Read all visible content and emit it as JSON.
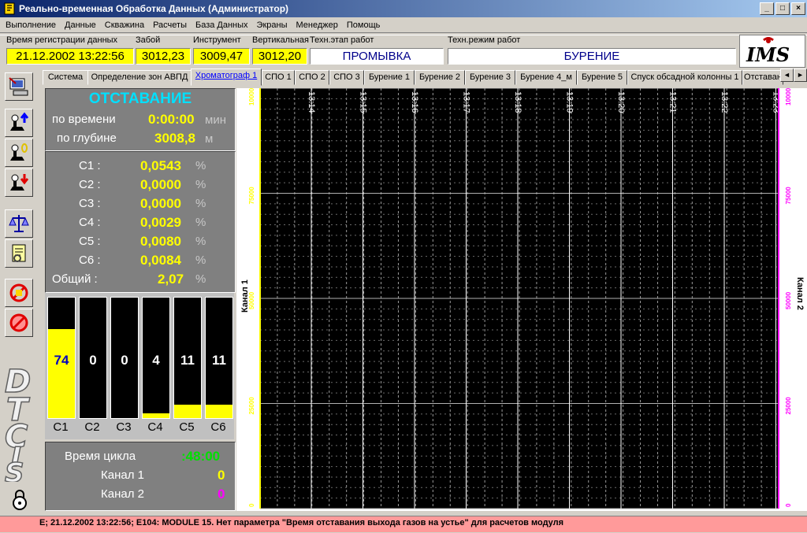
{
  "window": {
    "title": "Реально-временная Обработка Данных (Администратор)",
    "buttons": {
      "minimize": "_",
      "maximize": "□",
      "close": "×"
    }
  },
  "menu": [
    "Выполнение",
    "Данные",
    "Скважина",
    "Расчеты",
    "База Данных",
    "Экраны",
    "Менеджер",
    "Помощь"
  ],
  "info": {
    "reg_time_label": "Время регистрации данных",
    "reg_time": "21.12.2002 13:22:56",
    "bottom_label": "Забой",
    "bottom": "3012,23",
    "tool_label": "Инструмент",
    "tool": "3009,47",
    "vertical_label": "Вертикальная",
    "vertical": "3012,20",
    "stage_label": "Техн.этап работ",
    "stage": "ПРОМЫВКА",
    "mode_label": "Техн.режим работ",
    "mode": "БУРЕНИЕ",
    "logo_text": "IMS"
  },
  "tabs": [
    "Система",
    "Определение зон АВПД",
    "Хроматограф 1",
    "СПО 1",
    "СПО 2",
    "СПО 3",
    "Бурение 1",
    "Бурение 2",
    "Бурение 3",
    "Бурение 4_м",
    "Бурение 5",
    "Спуск обсадной колонны 1",
    "Отставан"
  ],
  "active_tab": 2,
  "tab_arrows": {
    "left": "◄",
    "right": "►"
  },
  "lag": {
    "title": "ОТСТАВАНИЕ",
    "time_label": "по времени",
    "time_value": "0:00:00",
    "time_unit": "мин",
    "depth_label": "по глубине",
    "depth_value": "3008,8",
    "depth_unit": "м"
  },
  "gases": [
    {
      "label": "C1 :",
      "value": "0,0543",
      "unit": "%"
    },
    {
      "label": "C2 :",
      "value": "0,0000",
      "unit": "%"
    },
    {
      "label": "C3 :",
      "value": "0,0000",
      "unit": "%"
    },
    {
      "label": "C4 :",
      "value": "0,0029",
      "unit": "%"
    },
    {
      "label": "C5 :",
      "value": "0,0080",
      "unit": "%"
    },
    {
      "label": "C6 :",
      "value": "0,0084",
      "unit": "%"
    },
    {
      "label": "Общий :",
      "value": "2,07",
      "unit": "%"
    }
  ],
  "bars": [
    {
      "label": "C1",
      "value": "74",
      "fill": 0.74
    },
    {
      "label": "C2",
      "value": "0",
      "fill": 0
    },
    {
      "label": "C3",
      "value": "0",
      "fill": 0
    },
    {
      "label": "C4",
      "value": "4",
      "fill": 0.04
    },
    {
      "label": "C5",
      "value": "11",
      "fill": 0.11
    },
    {
      "label": "C6",
      "value": "11",
      "fill": 0.11
    }
  ],
  "cycle": {
    "time_label": "Время цикла",
    "time_value": ":48:00",
    "ch1_label": "Канал 1",
    "ch1_value": "0",
    "ch2_label": "Канал 2",
    "ch2_value": "0"
  },
  "brand": "DTCIS",
  "chart_data": {
    "type": "line",
    "x_ticks": [
      "13:14",
      "13:15",
      "13:16",
      "13:17",
      "13:18",
      "13:19",
      "13:20",
      "13:21",
      "13:22",
      "13:23"
    ],
    "y_ticks": [
      "0",
      "25000",
      "50000",
      "75000",
      "100000"
    ],
    "ylabel_left": "Канал 1",
    "ylabel_right": "Канал 2",
    "ylim": [
      0,
      100000
    ],
    "grid": true,
    "series": [],
    "colors": {
      "left_axis": "#ffff00",
      "right_axis": "#ff00ff",
      "background": "#000000",
      "grid": "#ffffff"
    }
  },
  "status": "E; 21.12.2002 13:22:56; E104: MODULE 15. Нет параметра  \"Время отставания выхода газов на устье\" для расчетов модуля"
}
